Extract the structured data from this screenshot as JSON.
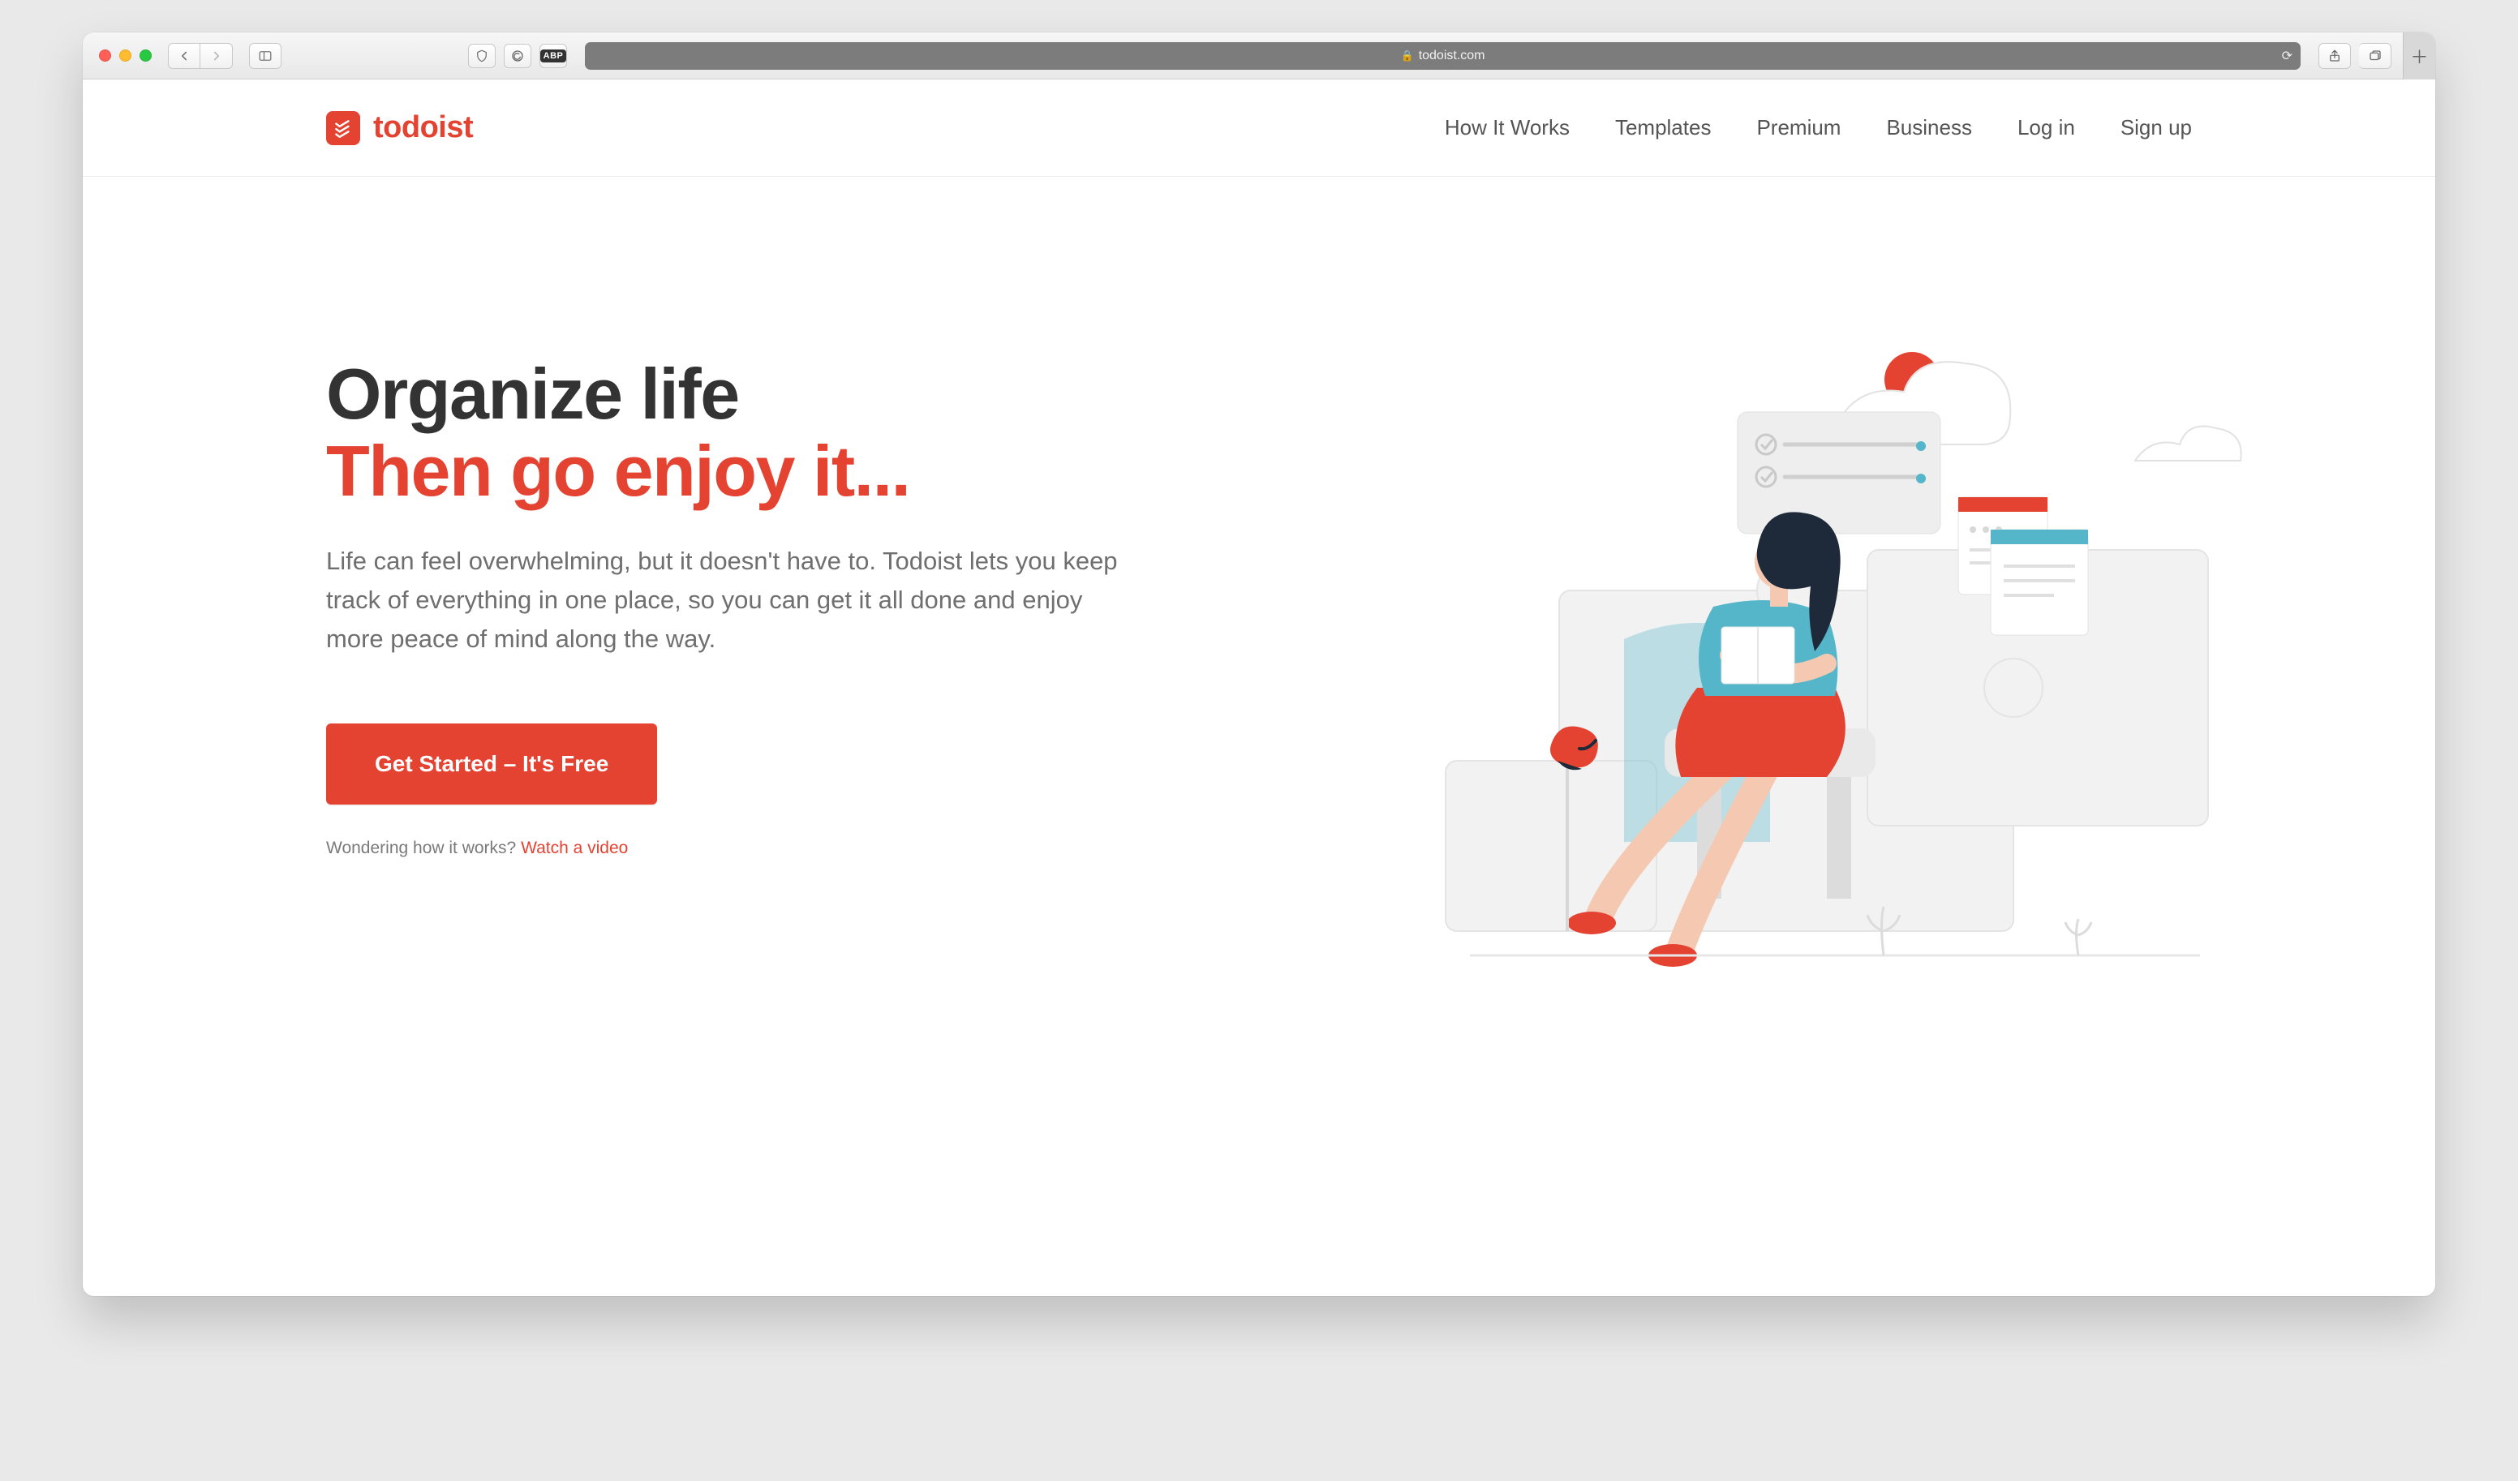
{
  "browser": {
    "url_display": "todoist.com",
    "adblock_badge": "ABP"
  },
  "brand": {
    "name": "todoist"
  },
  "nav": {
    "items": [
      {
        "label": "How It Works"
      },
      {
        "label": "Templates"
      },
      {
        "label": "Premium"
      },
      {
        "label": "Business"
      },
      {
        "label": "Log in"
      },
      {
        "label": "Sign up"
      }
    ]
  },
  "hero": {
    "title_line1": "Organize life",
    "title_line2": "Then go enjoy it...",
    "subtitle": "Life can feel overwhelming, but it doesn't have to. Todoist lets you keep track of everything in one place, so you can get it all done and enjoy more peace of mind along the way.",
    "cta_label": "Get Started – It's Free",
    "video_prompt": "Wondering how it works? ",
    "video_link": "Watch a video"
  },
  "colors": {
    "accent": "#e44332"
  }
}
